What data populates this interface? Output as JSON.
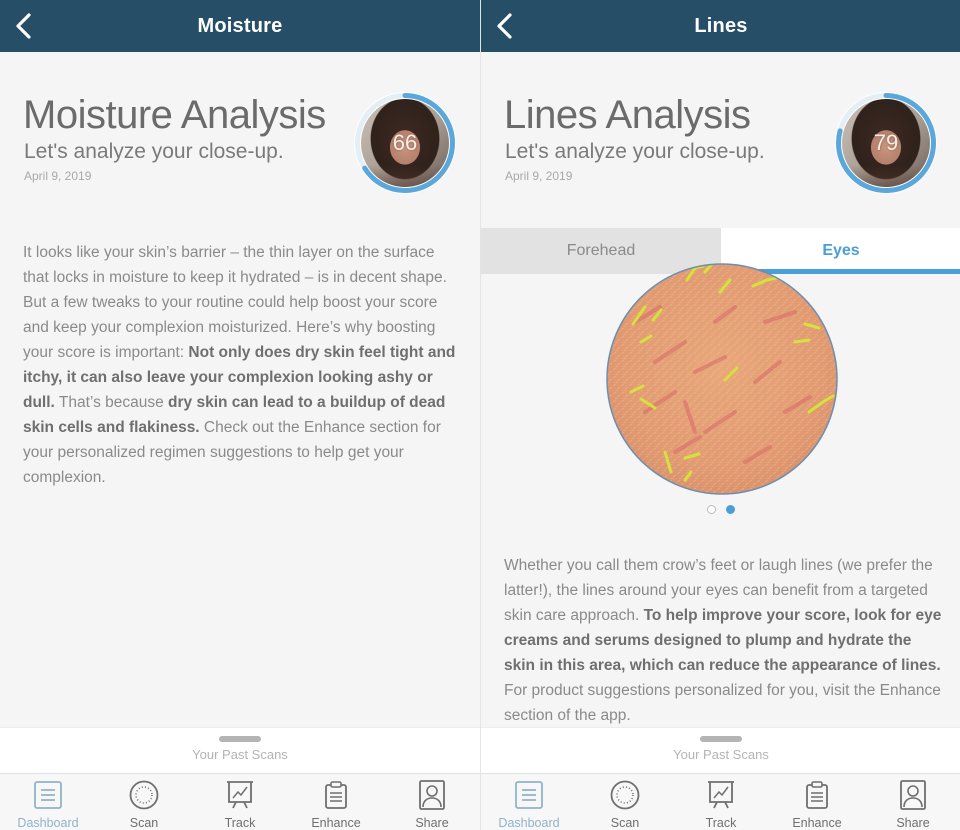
{
  "screens": [
    {
      "nav_title": "Moisture",
      "analysis_title": "Moisture Analysis",
      "subtitle": "Let's analyze your close-up.",
      "date": "April 9, 2019",
      "score": "66",
      "score_fraction": 0.66,
      "body": [
        {
          "t": "It looks like your skin’s barrier – the thin layer on the surface that locks in moisture to keep it hydrated – is in decent shape. But a few tweaks to your routine could help boost your score and keep your complexion moisturized. Here’s why boosting your score is important: ",
          "b": false
        },
        {
          "t": "Not only does dry skin feel tight and itchy, it can also leave your complexion looking ashy or dull.",
          "b": true
        },
        {
          "t": " That’s because ",
          "b": false
        },
        {
          "t": "dry skin can lead to a buildup of dead skin cells and flakiness.",
          "b": true
        },
        {
          "t": " Check out the Enhance section for your personalized regimen suggestions to help get your complexion.",
          "b": false
        }
      ],
      "past_scans_label": "Your Past Scans"
    },
    {
      "nav_title": "Lines",
      "analysis_title": "Lines Analysis",
      "subtitle": "Let's analyze your close-up.",
      "date": "April 9, 2019",
      "score": "79",
      "score_fraction": 0.79,
      "tabs": [
        {
          "label": "Forehead",
          "active": false
        },
        {
          "label": "Eyes",
          "active": true
        }
      ],
      "carousel": {
        "count": 2,
        "active_index": 1
      },
      "body": [
        {
          "t": "Whether you call them crow’s feet or laugh lines (we prefer the latter!), the lines around your eyes can benefit from a targeted skin care approach. ",
          "b": false
        },
        {
          "t": "To help improve your score, look for eye creams and serums designed to plump and hydrate the skin in this area, which can reduce the appearance of lines.",
          "b": true
        },
        {
          "t": " For product suggestions personalized for you, visit the Enhance section of the app.",
          "b": false
        }
      ],
      "past_scans_label": "Your Past Scans"
    }
  ],
  "tabbar": {
    "items": [
      {
        "label": "Dashboard",
        "icon": "dashboard-icon",
        "current": true
      },
      {
        "label": "Scan",
        "icon": "scan-icon",
        "current": false
      },
      {
        "label": "Track",
        "icon": "track-icon",
        "current": false
      },
      {
        "label": "Enhance",
        "icon": "enhance-icon",
        "current": false
      },
      {
        "label": "Share",
        "icon": "share-icon",
        "current": false
      }
    ]
  },
  "colors": {
    "navbar": "#264e66",
    "accent": "#4a9fd6",
    "dashboard_active": "#8fb3c9"
  }
}
